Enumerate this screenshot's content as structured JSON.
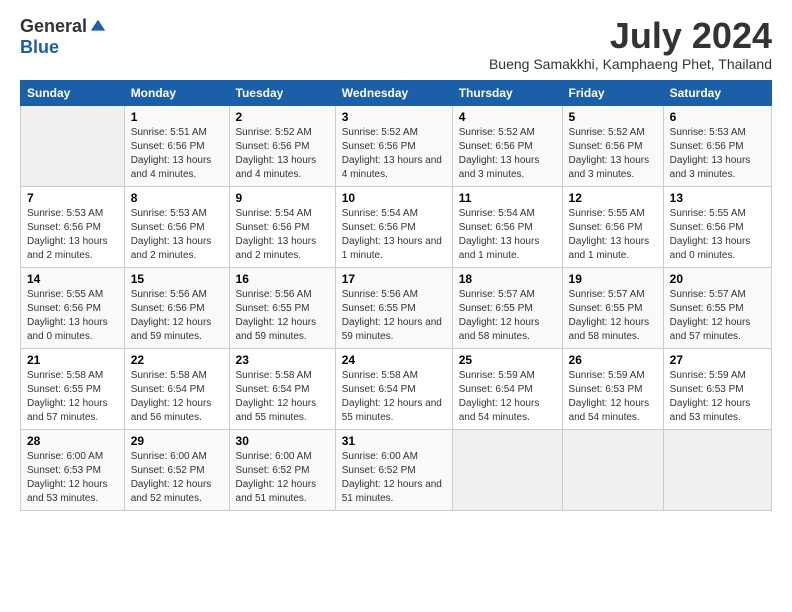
{
  "header": {
    "logo_general": "General",
    "logo_blue": "Blue",
    "month_title": "July 2024",
    "subtitle": "Bueng Samakkhi, Kamphaeng Phet, Thailand"
  },
  "calendar": {
    "weekdays": [
      "Sunday",
      "Monday",
      "Tuesday",
      "Wednesday",
      "Thursday",
      "Friday",
      "Saturday"
    ],
    "weeks": [
      [
        {
          "day": "",
          "sunrise": "",
          "sunset": "",
          "daylight": "",
          "empty": true
        },
        {
          "day": "1",
          "sunrise": "Sunrise: 5:51 AM",
          "sunset": "Sunset: 6:56 PM",
          "daylight": "Daylight: 13 hours and 4 minutes.",
          "empty": false
        },
        {
          "day": "2",
          "sunrise": "Sunrise: 5:52 AM",
          "sunset": "Sunset: 6:56 PM",
          "daylight": "Daylight: 13 hours and 4 minutes.",
          "empty": false
        },
        {
          "day": "3",
          "sunrise": "Sunrise: 5:52 AM",
          "sunset": "Sunset: 6:56 PM",
          "daylight": "Daylight: 13 hours and 4 minutes.",
          "empty": false
        },
        {
          "day": "4",
          "sunrise": "Sunrise: 5:52 AM",
          "sunset": "Sunset: 6:56 PM",
          "daylight": "Daylight: 13 hours and 3 minutes.",
          "empty": false
        },
        {
          "day": "5",
          "sunrise": "Sunrise: 5:52 AM",
          "sunset": "Sunset: 6:56 PM",
          "daylight": "Daylight: 13 hours and 3 minutes.",
          "empty": false
        },
        {
          "day": "6",
          "sunrise": "Sunrise: 5:53 AM",
          "sunset": "Sunset: 6:56 PM",
          "daylight": "Daylight: 13 hours and 3 minutes.",
          "empty": false
        }
      ],
      [
        {
          "day": "7",
          "sunrise": "Sunrise: 5:53 AM",
          "sunset": "Sunset: 6:56 PM",
          "daylight": "Daylight: 13 hours and 2 minutes.",
          "empty": false
        },
        {
          "day": "8",
          "sunrise": "Sunrise: 5:53 AM",
          "sunset": "Sunset: 6:56 PM",
          "daylight": "Daylight: 13 hours and 2 minutes.",
          "empty": false
        },
        {
          "day": "9",
          "sunrise": "Sunrise: 5:54 AM",
          "sunset": "Sunset: 6:56 PM",
          "daylight": "Daylight: 13 hours and 2 minutes.",
          "empty": false
        },
        {
          "day": "10",
          "sunrise": "Sunrise: 5:54 AM",
          "sunset": "Sunset: 6:56 PM",
          "daylight": "Daylight: 13 hours and 1 minute.",
          "empty": false
        },
        {
          "day": "11",
          "sunrise": "Sunrise: 5:54 AM",
          "sunset": "Sunset: 6:56 PM",
          "daylight": "Daylight: 13 hours and 1 minute.",
          "empty": false
        },
        {
          "day": "12",
          "sunrise": "Sunrise: 5:55 AM",
          "sunset": "Sunset: 6:56 PM",
          "daylight": "Daylight: 13 hours and 1 minute.",
          "empty": false
        },
        {
          "day": "13",
          "sunrise": "Sunrise: 5:55 AM",
          "sunset": "Sunset: 6:56 PM",
          "daylight": "Daylight: 13 hours and 0 minutes.",
          "empty": false
        }
      ],
      [
        {
          "day": "14",
          "sunrise": "Sunrise: 5:55 AM",
          "sunset": "Sunset: 6:56 PM",
          "daylight": "Daylight: 13 hours and 0 minutes.",
          "empty": false
        },
        {
          "day": "15",
          "sunrise": "Sunrise: 5:56 AM",
          "sunset": "Sunset: 6:56 PM",
          "daylight": "Daylight: 12 hours and 59 minutes.",
          "empty": false
        },
        {
          "day": "16",
          "sunrise": "Sunrise: 5:56 AM",
          "sunset": "Sunset: 6:55 PM",
          "daylight": "Daylight: 12 hours and 59 minutes.",
          "empty": false
        },
        {
          "day": "17",
          "sunrise": "Sunrise: 5:56 AM",
          "sunset": "Sunset: 6:55 PM",
          "daylight": "Daylight: 12 hours and 59 minutes.",
          "empty": false
        },
        {
          "day": "18",
          "sunrise": "Sunrise: 5:57 AM",
          "sunset": "Sunset: 6:55 PM",
          "daylight": "Daylight: 12 hours and 58 minutes.",
          "empty": false
        },
        {
          "day": "19",
          "sunrise": "Sunrise: 5:57 AM",
          "sunset": "Sunset: 6:55 PM",
          "daylight": "Daylight: 12 hours and 58 minutes.",
          "empty": false
        },
        {
          "day": "20",
          "sunrise": "Sunrise: 5:57 AM",
          "sunset": "Sunset: 6:55 PM",
          "daylight": "Daylight: 12 hours and 57 minutes.",
          "empty": false
        }
      ],
      [
        {
          "day": "21",
          "sunrise": "Sunrise: 5:58 AM",
          "sunset": "Sunset: 6:55 PM",
          "daylight": "Daylight: 12 hours and 57 minutes.",
          "empty": false
        },
        {
          "day": "22",
          "sunrise": "Sunrise: 5:58 AM",
          "sunset": "Sunset: 6:54 PM",
          "daylight": "Daylight: 12 hours and 56 minutes.",
          "empty": false
        },
        {
          "day": "23",
          "sunrise": "Sunrise: 5:58 AM",
          "sunset": "Sunset: 6:54 PM",
          "daylight": "Daylight: 12 hours and 55 minutes.",
          "empty": false
        },
        {
          "day": "24",
          "sunrise": "Sunrise: 5:58 AM",
          "sunset": "Sunset: 6:54 PM",
          "daylight": "Daylight: 12 hours and 55 minutes.",
          "empty": false
        },
        {
          "day": "25",
          "sunrise": "Sunrise: 5:59 AM",
          "sunset": "Sunset: 6:54 PM",
          "daylight": "Daylight: 12 hours and 54 minutes.",
          "empty": false
        },
        {
          "day": "26",
          "sunrise": "Sunrise: 5:59 AM",
          "sunset": "Sunset: 6:53 PM",
          "daylight": "Daylight: 12 hours and 54 minutes.",
          "empty": false
        },
        {
          "day": "27",
          "sunrise": "Sunrise: 5:59 AM",
          "sunset": "Sunset: 6:53 PM",
          "daylight": "Daylight: 12 hours and 53 minutes.",
          "empty": false
        }
      ],
      [
        {
          "day": "28",
          "sunrise": "Sunrise: 6:00 AM",
          "sunset": "Sunset: 6:53 PM",
          "daylight": "Daylight: 12 hours and 53 minutes.",
          "empty": false
        },
        {
          "day": "29",
          "sunrise": "Sunrise: 6:00 AM",
          "sunset": "Sunset: 6:52 PM",
          "daylight": "Daylight: 12 hours and 52 minutes.",
          "empty": false
        },
        {
          "day": "30",
          "sunrise": "Sunrise: 6:00 AM",
          "sunset": "Sunset: 6:52 PM",
          "daylight": "Daylight: 12 hours and 51 minutes.",
          "empty": false
        },
        {
          "day": "31",
          "sunrise": "Sunrise: 6:00 AM",
          "sunset": "Sunset: 6:52 PM",
          "daylight": "Daylight: 12 hours and 51 minutes.",
          "empty": false
        },
        {
          "day": "",
          "sunrise": "",
          "sunset": "",
          "daylight": "",
          "empty": true
        },
        {
          "day": "",
          "sunrise": "",
          "sunset": "",
          "daylight": "",
          "empty": true
        },
        {
          "day": "",
          "sunrise": "",
          "sunset": "",
          "daylight": "",
          "empty": true
        }
      ]
    ]
  }
}
